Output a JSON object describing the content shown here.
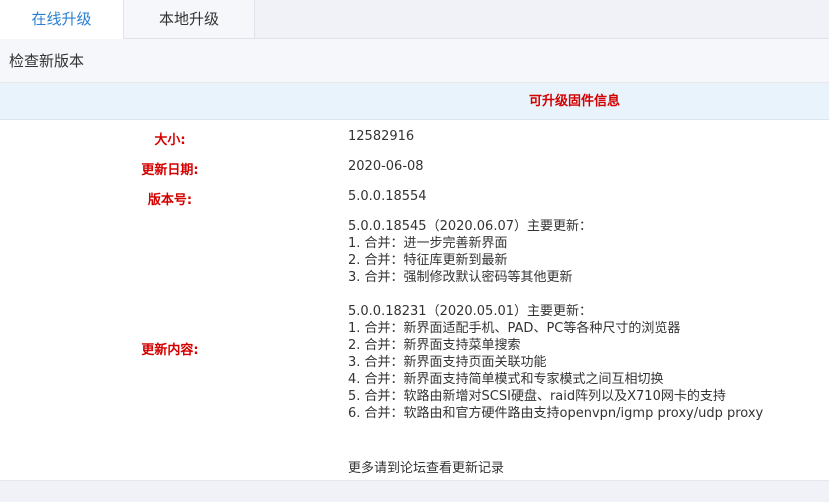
{
  "tabs": {
    "online": "在线升级",
    "local": "本地升级"
  },
  "section": {
    "title": "检查新版本"
  },
  "firmware": {
    "title": "可升级固件信息",
    "size_label": "大小:",
    "size_value": "12582916",
    "date_label": "更新日期:",
    "date_value": "2020-06-08",
    "version_label": "版本号:",
    "version_value": "5.0.0.18554",
    "content_label": "更新内容:",
    "content_lines": [
      "5.0.0.18545（2020.06.07）主要更新：",
      "1. 合并：进一步完善新界面",
      "2. 合并：特征库更新到最新",
      "3. 合并：强制修改默认密码等其他更新",
      "",
      "5.0.0.18231（2020.05.01）主要更新：",
      "1. 合并：新界面适配手机、PAD、PC等各种尺寸的浏览器",
      "2. 合并：新界面支持菜单搜索",
      "3. 合并：新界面支持页面关联功能",
      "4. 合并：新界面支持简单模式和专家模式之间互相切换",
      "5. 合并：软路由新增对SCSI硬盘、raid阵列以及X710网卡的支持",
      "6. 合并：软路由和官方硬件路由支持openvpn/igmp proxy/udp proxy"
    ],
    "more_text": "更多请到论坛查看更新记录"
  },
  "colors": {
    "accent_blue": "#2a7fd4",
    "label_red": "#d40000"
  }
}
